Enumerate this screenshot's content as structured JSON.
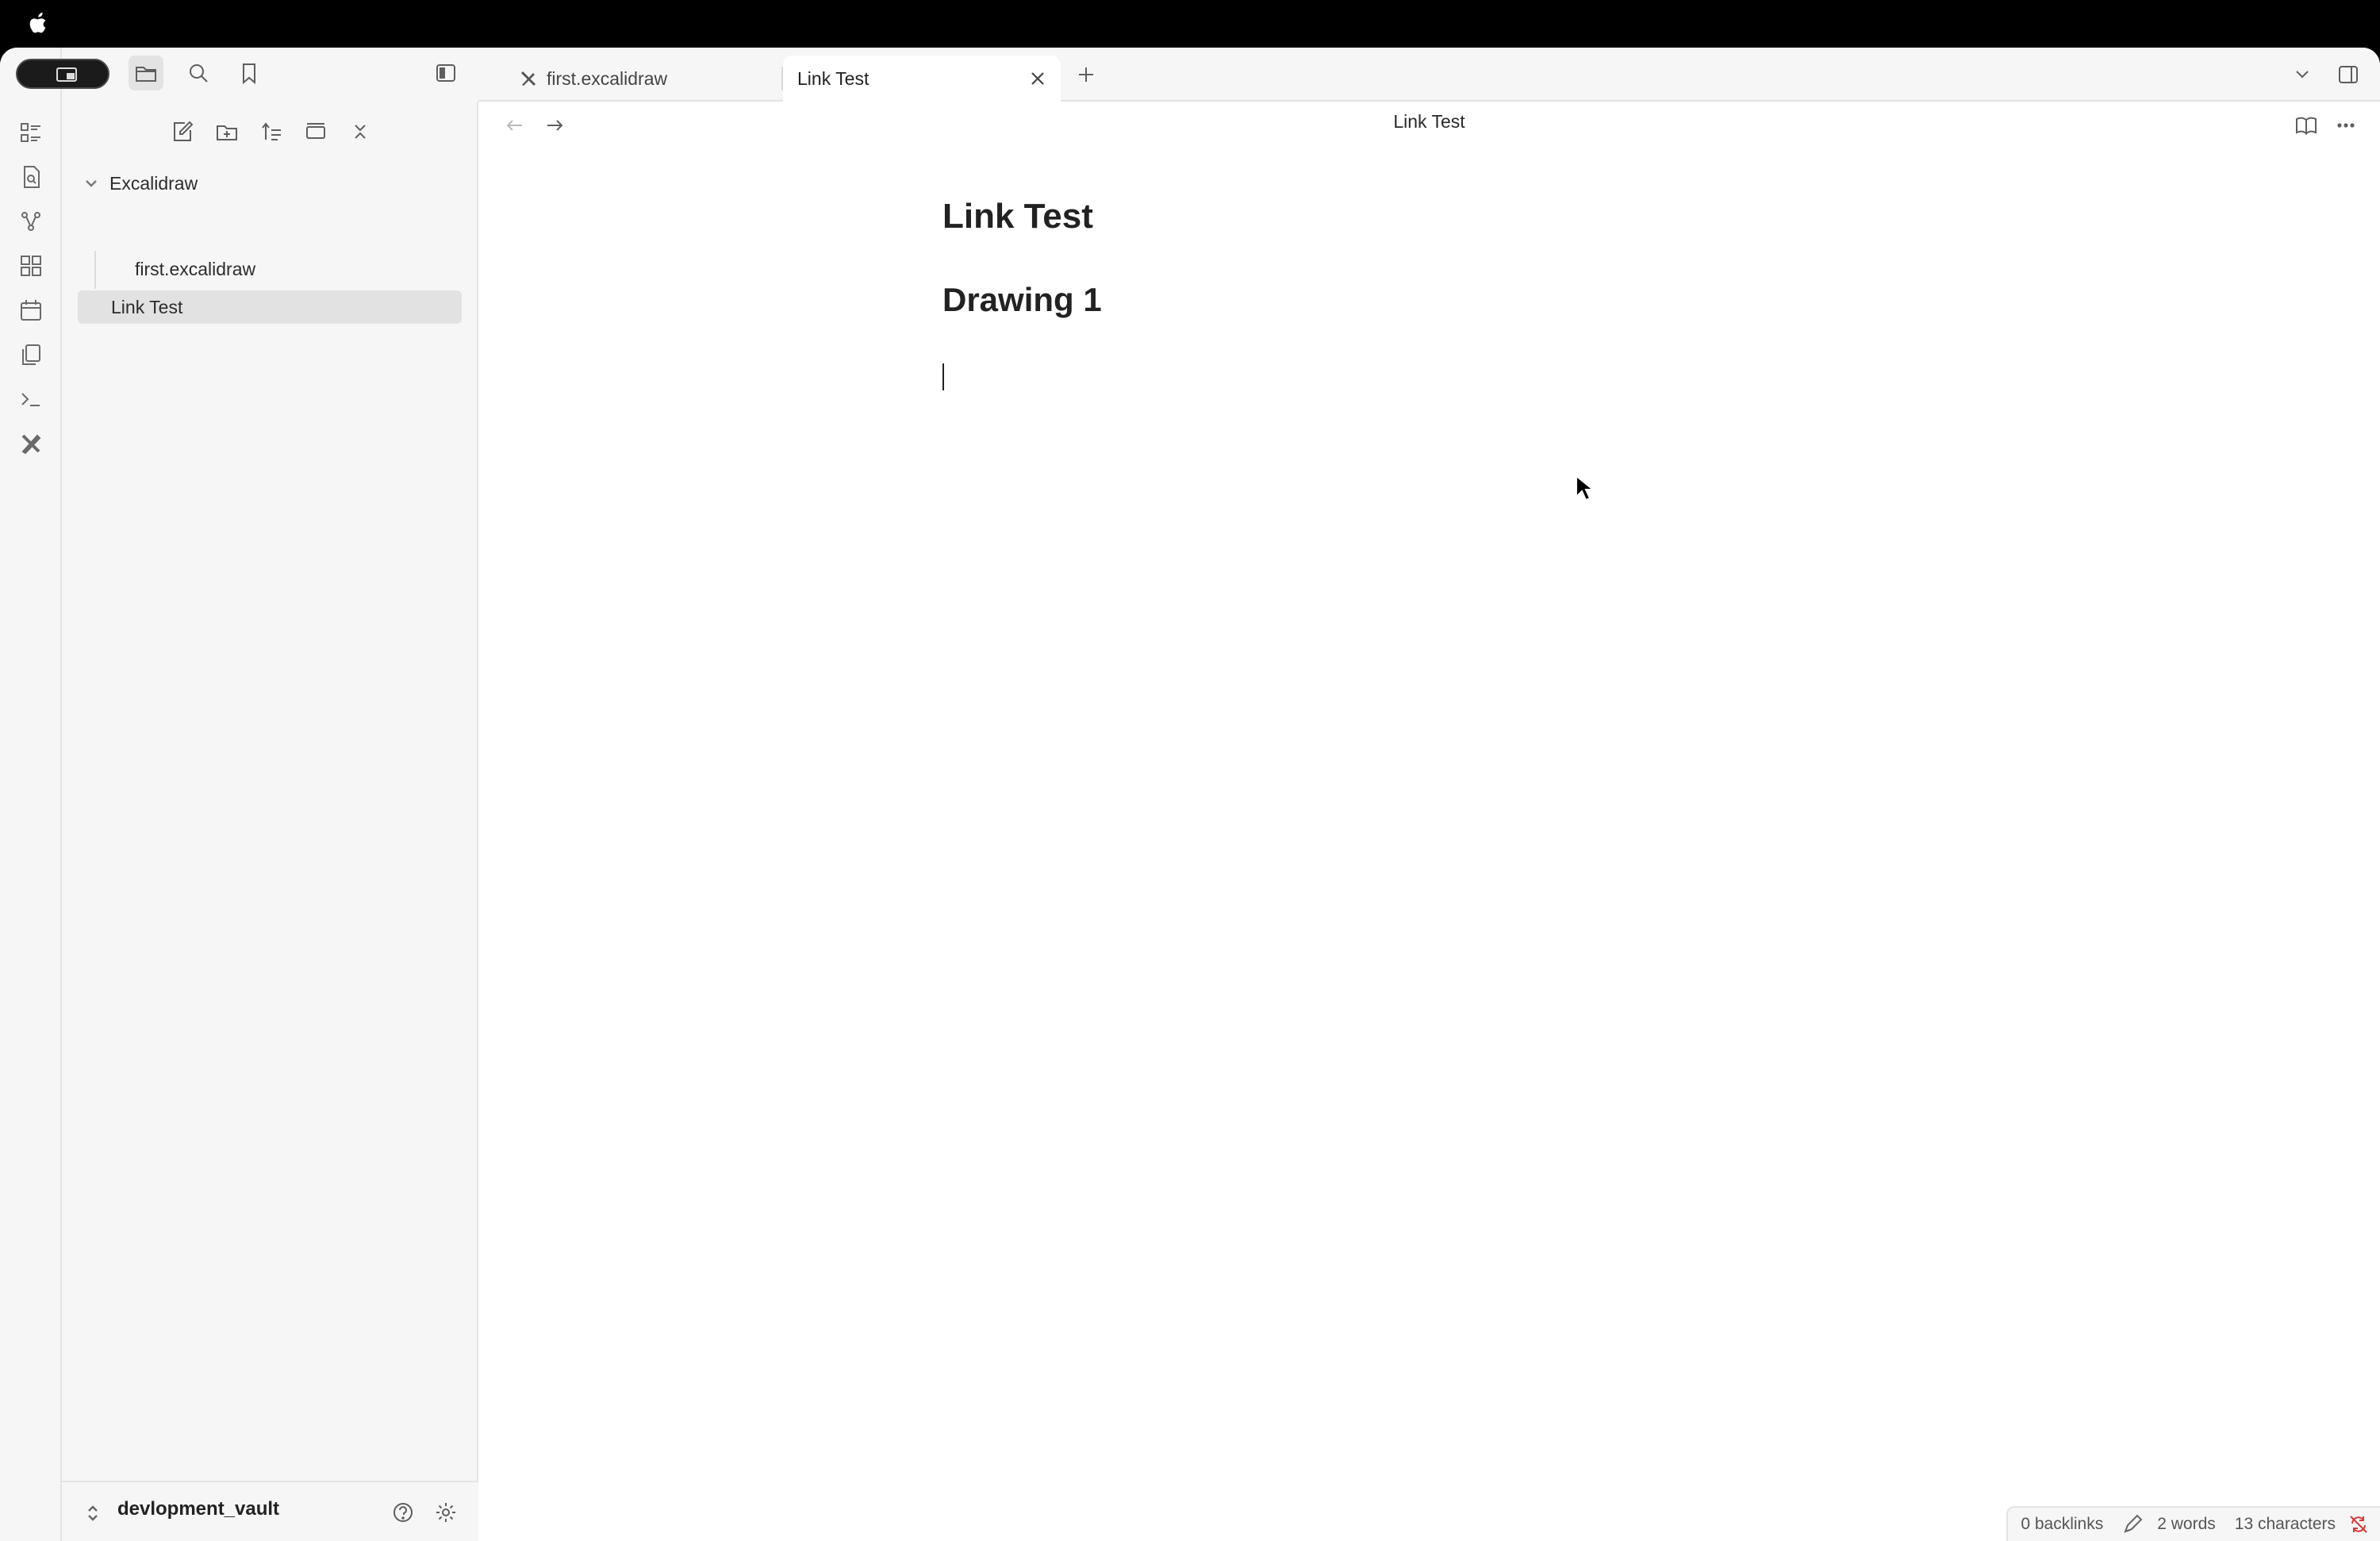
{
  "menubar": {
    "apple_icon": "apple-logo-icon"
  },
  "ribbon": {
    "items": [
      {
        "icon": "dashboard-icon"
      },
      {
        "icon": "file-search-icon"
      },
      {
        "icon": "graph-icon"
      },
      {
        "icon": "grid-icon"
      },
      {
        "icon": "calendar-icon"
      },
      {
        "icon": "copy-icon"
      },
      {
        "icon": "terminal-icon"
      },
      {
        "icon": "excalidraw-icon"
      }
    ]
  },
  "sidebar": {
    "tabs": [
      "files-icon",
      "search-icon",
      "bookmark-icon"
    ],
    "toolbar": [
      "new-note-icon",
      "new-folder-icon",
      "sort-icon",
      "collapse-icon",
      "close-all-icon"
    ],
    "tree": [
      {
        "label": "Excalidraw",
        "type": "folder",
        "expanded": true
      },
      {
        "label": "first.excalidraw",
        "type": "file",
        "indent": 1
      },
      {
        "label": "Link Test",
        "type": "file",
        "selected": true
      }
    ],
    "vault_name": "devlopment_vault"
  },
  "tabs": [
    {
      "label": "first.excalidraw",
      "icon": "excalidraw-icon",
      "active": false
    },
    {
      "label": "Link Test",
      "active": true
    }
  ],
  "view": {
    "title": "Link Test",
    "heading1": "Link Test",
    "heading2": "Drawing 1"
  },
  "status": {
    "backlinks": "0 backlinks",
    "words": "2 words",
    "characters": "13 characters"
  },
  "colors": {
    "accent": "#d33a3a",
    "sidebar_bg": "#f6f6f6",
    "selected_bg": "#e2e2e2"
  }
}
